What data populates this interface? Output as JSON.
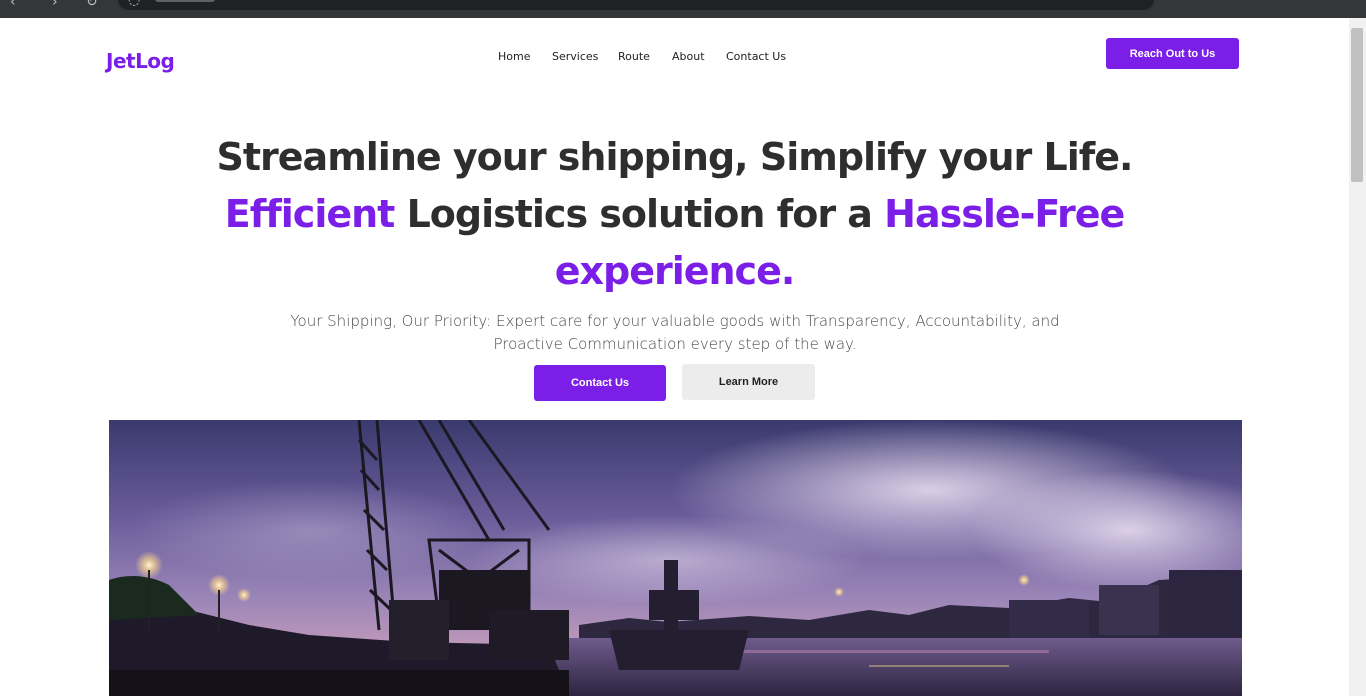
{
  "brand": {
    "logo": "JetLog"
  },
  "nav": {
    "items": [
      "Home",
      "Services",
      "Route",
      "About",
      "Contact Us"
    ],
    "cta": "Reach Out to Us"
  },
  "hero": {
    "line1": "Streamline your shipping, Simplify your Life.",
    "line2_accent1": "Efficient",
    "line2_mid": " Logistics solution for a ",
    "line2_accent2": "Hassle-Free",
    "line3": "experience.",
    "subtitle": "Your Shipping, Our Priority: Expert care for your valuable goods with Transparency, Accountability, and Proactive Communication every step of the way.",
    "primary_button": "Contact Us",
    "secondary_button": "Learn More"
  },
  "image": {
    "subject": "harbor cranes at dusk"
  },
  "colors": {
    "accent": "#7b1fe8",
    "text": "#2e2e2e",
    "secondary_button_bg": "#ececec"
  }
}
